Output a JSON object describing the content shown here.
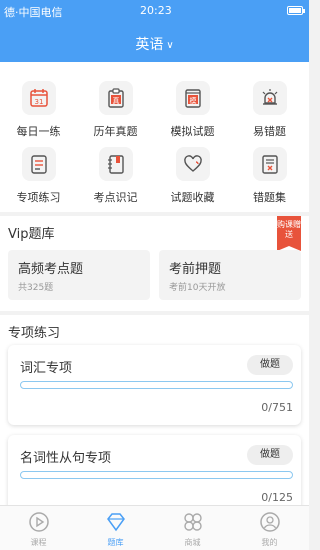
{
  "status_bar": {
    "left_text": "德·中国电信",
    "time": "20:23"
  },
  "header": {
    "subject": "英语",
    "chevron": "∨"
  },
  "grid": [
    {
      "label": "每日一练",
      "icon": "calendar-icon",
      "icon_text": "31"
    },
    {
      "label": "历年真题",
      "icon": "clipboard-icon",
      "icon_text": "真"
    },
    {
      "label": "模拟试题",
      "icon": "mock-paper-icon",
      "icon_text": "模"
    },
    {
      "label": "易错题",
      "icon": "alarm-icon",
      "icon_text": ""
    },
    {
      "label": "专项练习",
      "icon": "document-icon",
      "icon_text": ""
    },
    {
      "label": "考点识记",
      "icon": "notebook-icon",
      "icon_text": ""
    },
    {
      "label": "试题收藏",
      "icon": "heart-icon",
      "icon_text": ""
    },
    {
      "label": "错题集",
      "icon": "error-list-icon",
      "icon_text": ""
    }
  ],
  "vip": {
    "title": "Vip题库",
    "ribbon": "购课赠送",
    "cards": [
      {
        "title": "高频考点题",
        "sub": "共325题"
      },
      {
        "title": "考前押题",
        "sub": "考前10天开放"
      }
    ]
  },
  "special": {
    "title": "专项练习",
    "items": [
      {
        "name": "词汇专项",
        "button": "做题",
        "count": "0/751",
        "progress": 0
      },
      {
        "name": "名词性从句专项",
        "button": "做题",
        "count": "0/125",
        "progress": 0
      }
    ]
  },
  "tabs": [
    {
      "label": "课程",
      "icon": "play-icon",
      "active": false
    },
    {
      "label": "题库",
      "icon": "diamond-icon",
      "active": true
    },
    {
      "label": "商城",
      "icon": "store-icon",
      "active": false
    },
    {
      "label": "我的",
      "icon": "user-icon",
      "active": false
    }
  ],
  "colors": {
    "accent": "#4a9ff5",
    "red": "#e8533b"
  }
}
